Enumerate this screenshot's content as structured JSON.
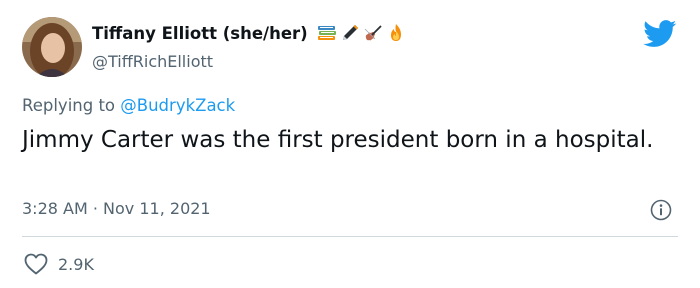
{
  "tweet": {
    "display_name": "Tiffany Elliott (she/her)",
    "handle": "@TiffRichElliott",
    "name_emojis": [
      "books-icon",
      "pen-icon",
      "violin-icon",
      "fire-icon"
    ],
    "reply_prefix": "Replying to",
    "reply_to": "@BudrykZack",
    "text": "Jimmy Carter was the first president born in a hospital.",
    "time": "3:28 AM",
    "separator": "·",
    "date": "Nov 11, 2021",
    "likes": "2.9K"
  },
  "colors": {
    "twitter_blue": "#1d9bf0",
    "secondary_text": "#536471",
    "primary_text": "#0f1419",
    "divider": "#cfd9de"
  }
}
